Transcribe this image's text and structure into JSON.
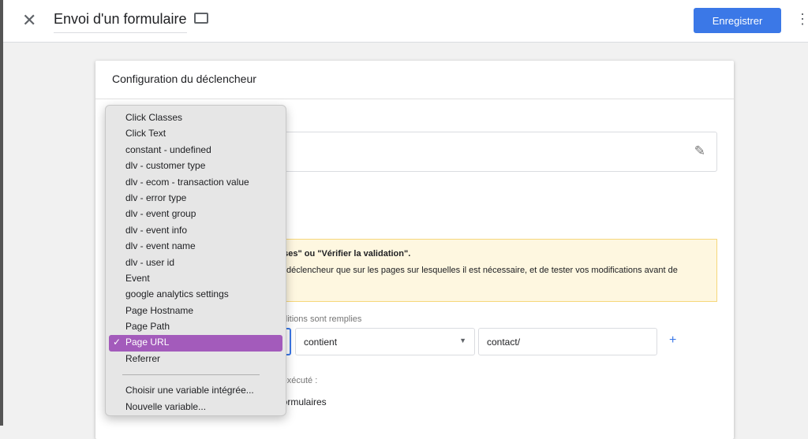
{
  "header": {
    "title": "Envoi d'un formulaire",
    "save_label": "Enregistrer"
  },
  "card": {
    "title": "Configuration du déclencheur",
    "warning_bold": "lises\" ou \"Vérifier la validation\".",
    "warning_text": "déclencheur que sur les pages sur lesquelles il est nécessaire, et de tester vos modifications avant de",
    "conditions_label": "nditions sont remplies",
    "operator": "contient",
    "value": "contact/",
    "fires_label": "st exécuté :",
    "fires_option": "s formulaires"
  },
  "dropdown": {
    "items": [
      "Click Classes",
      "Click Text",
      "constant - undefined",
      "dlv - customer type",
      "dlv - ecom - transaction value",
      "dlv - error type",
      "dlv - event group",
      "dlv - event info",
      "dlv - event name",
      "dlv - user id",
      "Event",
      "google analytics settings",
      "Page Hostname",
      "Page Path",
      "Page URL",
      "Referrer"
    ],
    "selected": "Page URL",
    "extra": [
      "Choisir une variable intégrée...",
      "Nouvelle variable..."
    ]
  },
  "colors": {
    "accent": "#3b78e7",
    "highlight": "#a35bbb",
    "warning_bg": "#fef7e0"
  }
}
